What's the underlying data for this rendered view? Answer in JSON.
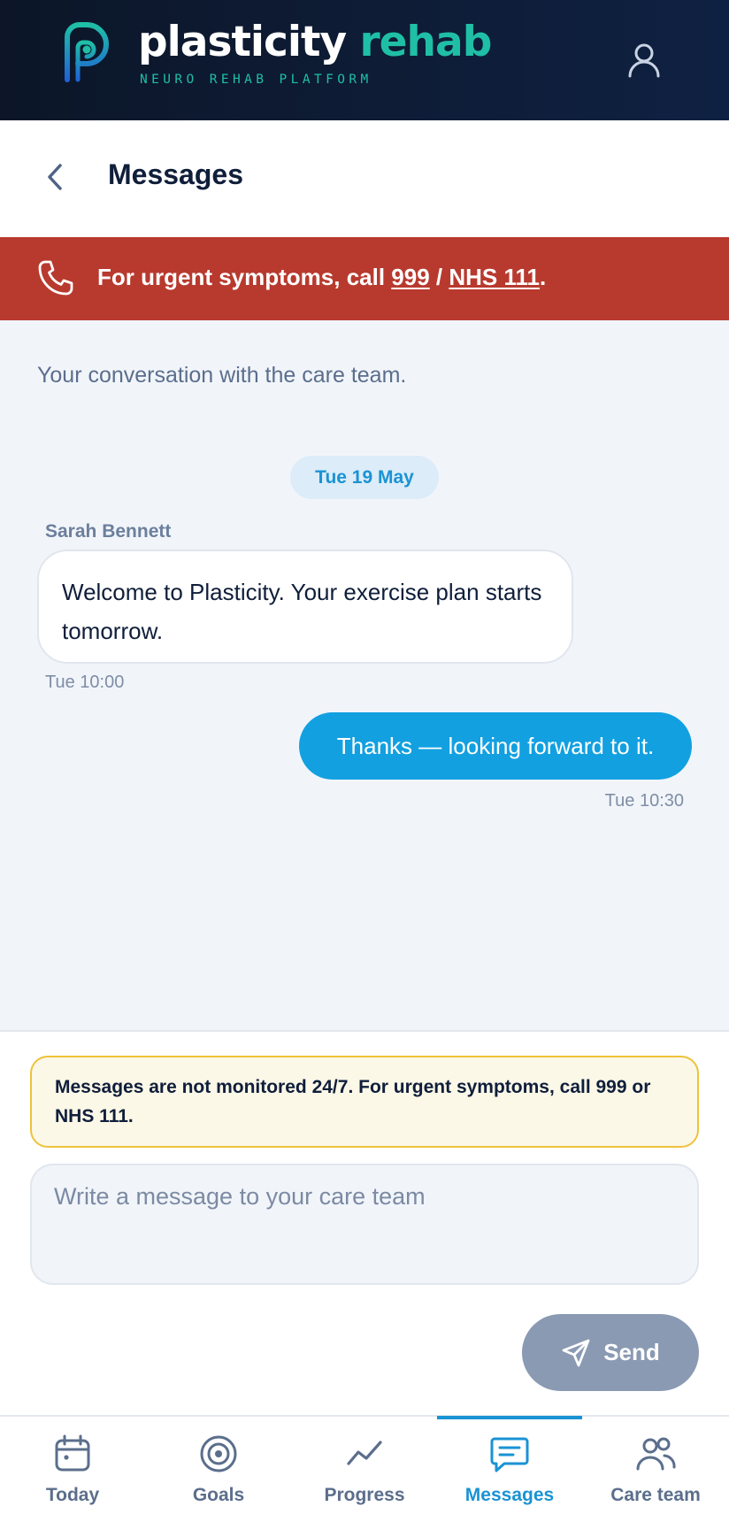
{
  "header": {
    "brand_main": "plasticity",
    "brand_accent": "rehab",
    "tagline": "NEURO REHAB PLATFORM",
    "logo_icon": "plasticity-p-logo",
    "profile_icon": "user-icon"
  },
  "page": {
    "title": "Messages",
    "back_icon": "chevron-left-icon"
  },
  "urgent_banner": {
    "prefix": "For urgent symptoms, call ",
    "number_1": "999",
    "separator": " / ",
    "number_2": "NHS 111",
    "suffix": ".",
    "icon": "phone-icon"
  },
  "conversation": {
    "intro": "Your conversation with the care team.",
    "date_chip": "Tue 19 May",
    "messages": [
      {
        "direction": "incoming",
        "sender": "Sarah Bennett",
        "text": "Welcome to Plasticity. Your exercise plan starts tomorrow.",
        "time": "Tue 10:00"
      },
      {
        "direction": "outgoing",
        "text": "Thanks — looking forward to it.",
        "time": "Tue 10:30"
      }
    ]
  },
  "composer": {
    "notice": "Messages are not monitored 24/7. For urgent symptoms, call 999 or NHS 111.",
    "input_value": "",
    "input_placeholder": "Write a message to your care team",
    "send_label": "Send",
    "send_icon": "send-icon"
  },
  "bottom_nav": {
    "items": [
      {
        "label": "Today",
        "icon": "calendar-icon",
        "active": false
      },
      {
        "label": "Goals",
        "icon": "target-icon",
        "active": false
      },
      {
        "label": "Progress",
        "icon": "trend-line-icon",
        "active": false
      },
      {
        "label": "Messages",
        "icon": "message-icon",
        "active": true
      },
      {
        "label": "Care team",
        "icon": "people-icon",
        "active": false
      }
    ]
  },
  "colors": {
    "header_bg": "#0c1628",
    "brand_teal": "#1fbfa6",
    "urgent_red": "#b83a2e",
    "accent_blue": "#12a0e1",
    "notice_border": "#eec23a",
    "send_disabled": "#8a9ab3"
  }
}
